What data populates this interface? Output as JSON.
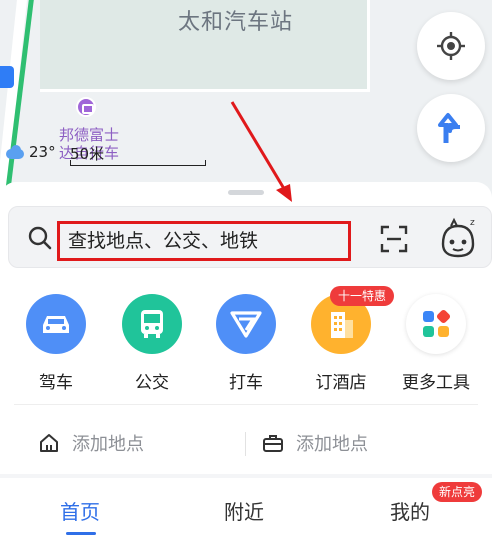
{
  "map": {
    "station_name": "太和汽车站",
    "poi_name": "邦德富士达自行车",
    "weather_temp": "23°",
    "scale": "50米"
  },
  "search": {
    "placeholder": "查找地点、公交、地铁"
  },
  "quick_actions": [
    {
      "label": "驾车",
      "color": "#4f8ff7",
      "icon": "car-icon"
    },
    {
      "label": "公交",
      "color": "#20c49a",
      "icon": "bus-icon"
    },
    {
      "label": "打车",
      "color": "#4f8ff7",
      "icon": "taxi-icon"
    },
    {
      "label": "订酒店",
      "color": "#ffb22e",
      "icon": "hotel-icon",
      "badge": "十一特惠"
    },
    {
      "label": "更多工具",
      "color": "#ffffff",
      "icon": "more-tools-icon"
    }
  ],
  "addresses": {
    "home_label": "添加地点",
    "work_label": "添加地点"
  },
  "tabs": [
    {
      "label": "首页",
      "active": true
    },
    {
      "label": "附近",
      "active": false
    },
    {
      "label": "我的",
      "active": false,
      "badge": "新点亮"
    }
  ],
  "colors": {
    "accent": "#2f6fe8",
    "highlight_red": "#e0191b",
    "badge_red": "#ef3b3b"
  }
}
